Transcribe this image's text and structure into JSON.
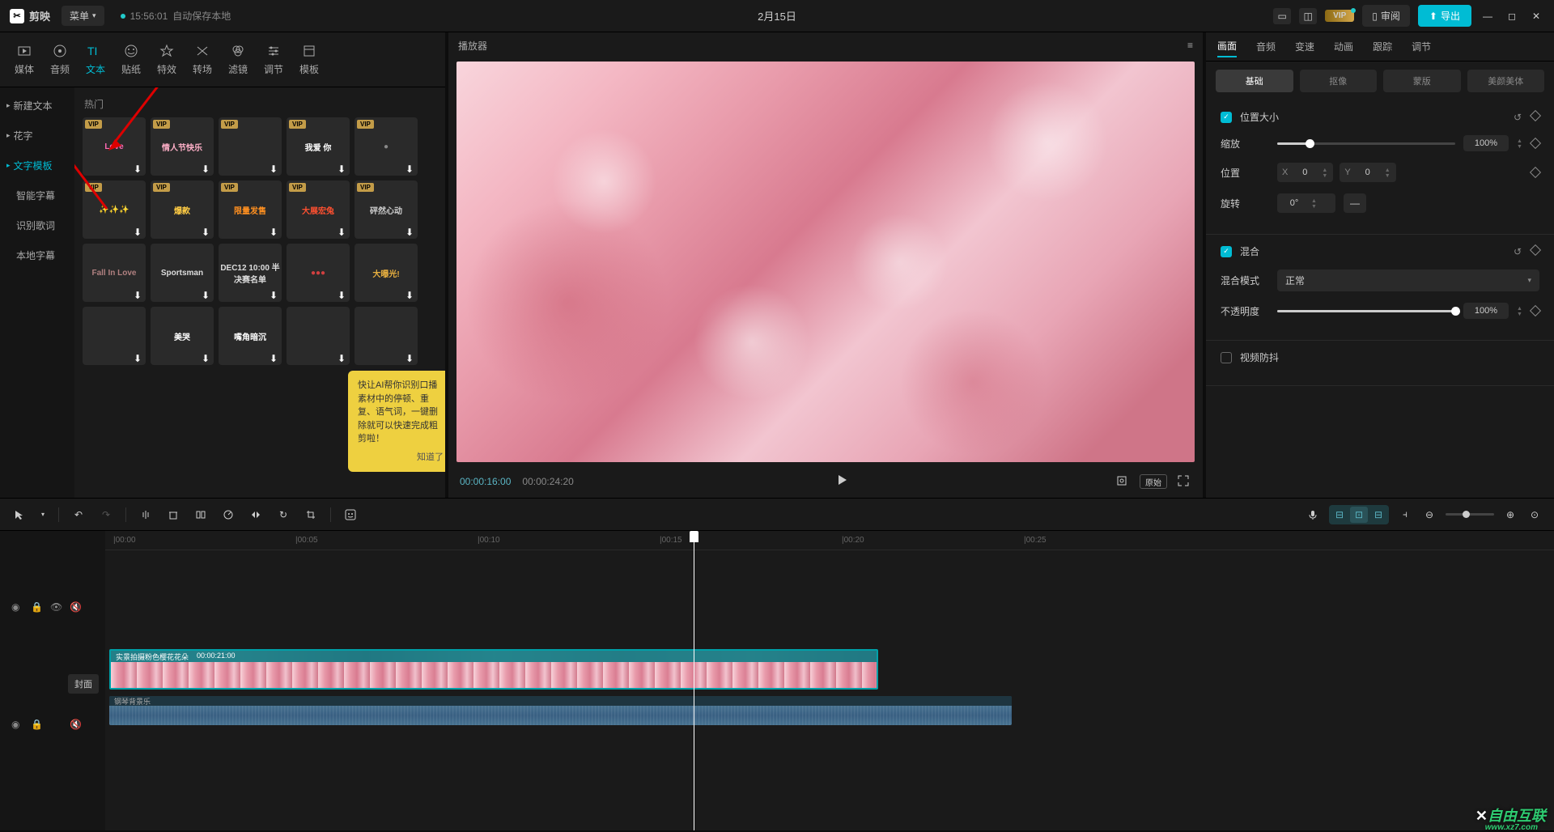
{
  "titlebar": {
    "app": "剪映",
    "menu": "菜单",
    "autosave_time": "15:56:01",
    "autosave_text": "自动保存本地",
    "project": "2月15日",
    "vip": "VIP",
    "review": "审阅",
    "export": "导出"
  },
  "nav": {
    "media": "媒体",
    "audio": "音频",
    "text": "文本",
    "sticker": "贴纸",
    "effect": "特效",
    "transition": "转场",
    "filter": "滤镜",
    "adjust": "调节",
    "template": "模板"
  },
  "sidebar": {
    "new_text": "新建文本",
    "huazi": "花字",
    "text_template": "文字模板",
    "smart_caption": "智能字幕",
    "lyric": "识别歌词",
    "local_caption": "本地字幕"
  },
  "content": {
    "hot": "热门"
  },
  "templates": [
    {
      "vip": "VIP",
      "text": "Love",
      "color": "#ff6ab5"
    },
    {
      "vip": "VIP",
      "text": "情人节快乐",
      "color": "#ffb0c8"
    },
    {
      "vip": "VIP",
      "text": "",
      "color": "#888"
    },
    {
      "vip": "VIP",
      "text": "我爱 你",
      "color": "#fff"
    },
    {
      "vip": "VIP",
      "text": "●",
      "color": "#888"
    },
    {
      "vip": "VIP",
      "text": "✨✨✨",
      "color": "#e8c050"
    },
    {
      "vip": "VIP",
      "text": "爆款",
      "color": "#ffcc44"
    },
    {
      "vip": "VIP",
      "text": "限量发售",
      "color": "#ff9020"
    },
    {
      "vip": "VIP",
      "text": "大展宏兔",
      "color": "#ff5030"
    },
    {
      "vip": "VIP",
      "text": "砰然心动",
      "color": "#ccc"
    },
    {
      "vip": "",
      "text": "Fall In Love",
      "color": "#b08080"
    },
    {
      "vip": "",
      "text": "Sportsman",
      "color": "#ddd"
    },
    {
      "vip": "",
      "text": "DEC12 10:00\n半决赛名单",
      "color": "#ddd"
    },
    {
      "vip": "",
      "text": "●●●",
      "color": "#d04040"
    },
    {
      "vip": "",
      "text": "大曝光!",
      "color": "#e8b040"
    },
    {
      "vip": "",
      "text": "",
      "color": "#888"
    },
    {
      "vip": "",
      "text": "美哭",
      "color": "#fff"
    },
    {
      "vip": "",
      "text": "嘴角暗沉",
      "color": "#fff"
    },
    {
      "vip": "",
      "text": "",
      "color": "#888"
    },
    {
      "vip": "",
      "text": "",
      "color": "#888"
    }
  ],
  "tooltip": {
    "text": "快让AI帮你识别口播素材中的停顿、重复、语气词，一键删除就可以快速完成粗剪啦！",
    "btn": "知道了"
  },
  "player": {
    "title": "播放器",
    "time": "00:00:16:00",
    "total": "00:00:24:20",
    "ratio": "原始"
  },
  "props": {
    "tabs": {
      "picture": "画面",
      "audio": "音频",
      "speed": "变速",
      "animation": "动画",
      "track": "跟踪",
      "adjust": "调节"
    },
    "subtabs": {
      "basic": "基础",
      "mask": "抠像",
      "mask2": "蒙版",
      "beauty": "美颜美体"
    },
    "position_size": "位置大小",
    "scale": "缩放",
    "scale_val": "100%",
    "position": "位置",
    "x": "X",
    "x_val": "0",
    "y": "Y",
    "y_val": "0",
    "rotation": "旋转",
    "rotation_val": "0°",
    "blend": "混合",
    "blend_mode": "混合模式",
    "blend_normal": "正常",
    "opacity": "不透明度",
    "opacity_val": "100%",
    "stabilize": "视频防抖"
  },
  "timeline": {
    "ticks": [
      "00:00",
      "00:05",
      "00:10",
      "00:15",
      "00:20",
      "00:25"
    ],
    "cover": "封面",
    "clip_name": "实景拍摄粉色樱花花朵",
    "clip_time": "00:00:21:00",
    "audio_name": "钢琴背景乐"
  },
  "watermark": {
    "brand": "自由互联",
    "url": "www.xz7.com"
  }
}
